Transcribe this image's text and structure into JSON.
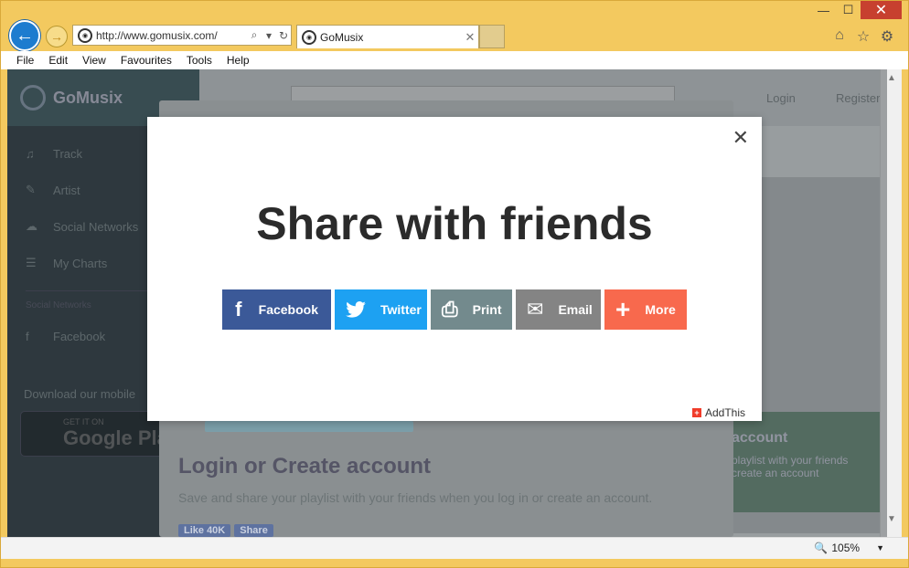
{
  "window": {
    "minimize": "—",
    "maximize": "☐",
    "close": "✕"
  },
  "nav": {
    "back_icon": "←",
    "forward_icon": "→",
    "url": "http://www.gomusix.com/",
    "search_icon": "⌕",
    "dropdown_icon": "▾",
    "refresh_icon": "↻",
    "tab_title": "GoMusix",
    "tab_close": "✕",
    "home_icon": "⌂",
    "favorites_icon": "☆",
    "settings_icon": "⚙"
  },
  "menu": [
    "File",
    "Edit",
    "View",
    "Favourites",
    "Tools",
    "Help"
  ],
  "site": {
    "logo": "GoMusix",
    "sidebar_items": [
      {
        "icon": "♫",
        "label": "Track"
      },
      {
        "icon": "✎",
        "label": "Artist"
      },
      {
        "icon": "☁",
        "label": "Social Networks"
      },
      {
        "icon": "☰",
        "label": "My Charts"
      }
    ],
    "sidebar_header": "Social Networks",
    "social_item": {
      "icon": "f",
      "label": "Facebook"
    },
    "download_text": "Download our mobile",
    "gplay_small": "GET IT ON",
    "gplay_big": "Google Pla",
    "login_link": "Login",
    "register_link": "Register",
    "right_heading": "account",
    "right_text": "playlist with your friends\ncreate an account",
    "login_title": "Login or Create account",
    "login_desc": "Save and share your playlist with your friends when you log in or create an account.",
    "like_label": "Like 40K",
    "share_label": "Share"
  },
  "share_modal": {
    "title": "Share with friends",
    "close": "✕",
    "buttons": [
      {
        "label": "Facebook",
        "icon": "f",
        "color": "#3b5998"
      },
      {
        "label": "Twitter",
        "icon": "🐦",
        "color": "#1da1f2"
      },
      {
        "label": "Print",
        "icon": "⎙",
        "color": "#738a8d"
      },
      {
        "label": "Email",
        "icon": "✉",
        "color": "#848484"
      },
      {
        "label": "More",
        "icon": "+",
        "color": "#f8694d"
      }
    ],
    "brand": "AddThis"
  },
  "status": {
    "zoom": "105%"
  }
}
